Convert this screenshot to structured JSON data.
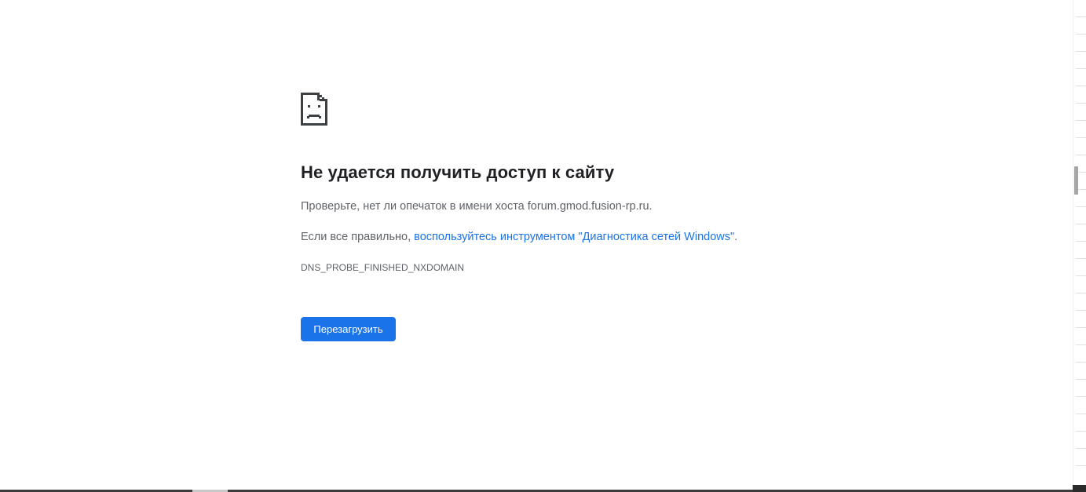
{
  "error_page": {
    "icon": "sad-page-icon",
    "heading": "Не удается получить доступ к сайту",
    "check_text": "Проверьте, нет ли опечаток в имени хоста forum.gmod.fusion-rp.ru.",
    "if_correct_prefix": "Если все правильно, ",
    "diagnostics_link": "воспользуйтесь инструментом \"Диагностика сетей Windows\"",
    "if_correct_suffix": ".",
    "error_code": "DNS_PROBE_FINISHED_NXDOMAIN",
    "reload_label": "Перезагрузить"
  },
  "colors": {
    "heading": "#202124",
    "text": "#5f6368",
    "link": "#1a73e8",
    "button_bg": "#1a73e8",
    "button_text": "#ffffff"
  }
}
